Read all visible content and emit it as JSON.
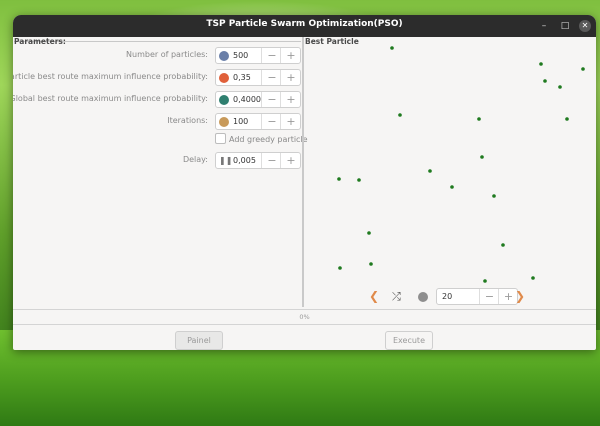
{
  "window": {
    "title": "TSP Particle Swarm Optimization(PSO)"
  },
  "controls": {
    "minimize": "–",
    "maximize": "□",
    "close": "✕"
  },
  "parameters": {
    "frame_title": "Parameters:",
    "rows": [
      {
        "label": "Number of particles:",
        "value": "500",
        "icon": "particles-icon",
        "icon_color": "#6a7fa8"
      },
      {
        "label": "Particle best route maximum influence probability:",
        "value": "0,35",
        "icon": "burst-icon",
        "icon_color": "#e0603a"
      },
      {
        "label": "Global best route maximum influence probability:",
        "value": "0,4000",
        "icon": "globe-icon",
        "icon_color": "#2f7f6f"
      },
      {
        "label": "Iterations:",
        "value": "100",
        "icon": "cookie-icon",
        "icon_color": "#c89a5a"
      }
    ],
    "greedy_checkbox": {
      "label": "Add greedy particle",
      "checked": false
    },
    "delay": {
      "label": "Delay:",
      "value": "0,005",
      "icon": "pause-icon"
    },
    "minus": "−",
    "plus": "+"
  },
  "best_particle": {
    "frame_title": "Best Particle",
    "point_color": "#1f7a1f",
    "nav": {
      "prev": "❮",
      "next": "❯",
      "shuffle": "⤮",
      "speed_value": "20"
    }
  },
  "chart_data": {
    "type": "scatter",
    "title": "",
    "xlim": [
      0,
      290
    ],
    "ylim": [
      0,
      240
    ],
    "points": [
      [
        87,
        5
      ],
      [
        236,
        21
      ],
      [
        278,
        26
      ],
      [
        240,
        38
      ],
      [
        255,
        44
      ],
      [
        95,
        72
      ],
      [
        174,
        76
      ],
      [
        262,
        76
      ],
      [
        177,
        114
      ],
      [
        125,
        128
      ],
      [
        54,
        137
      ],
      [
        34,
        136
      ],
      [
        147,
        144
      ],
      [
        189,
        153
      ],
      [
        64,
        190
      ],
      [
        198,
        202
      ],
      [
        66,
        221
      ],
      [
        35,
        225
      ],
      [
        228,
        235
      ],
      [
        180,
        238
      ]
    ]
  },
  "progress": {
    "text": "0%",
    "value": 0
  },
  "buttons": {
    "painel": "Painel",
    "execute": "Execute"
  }
}
